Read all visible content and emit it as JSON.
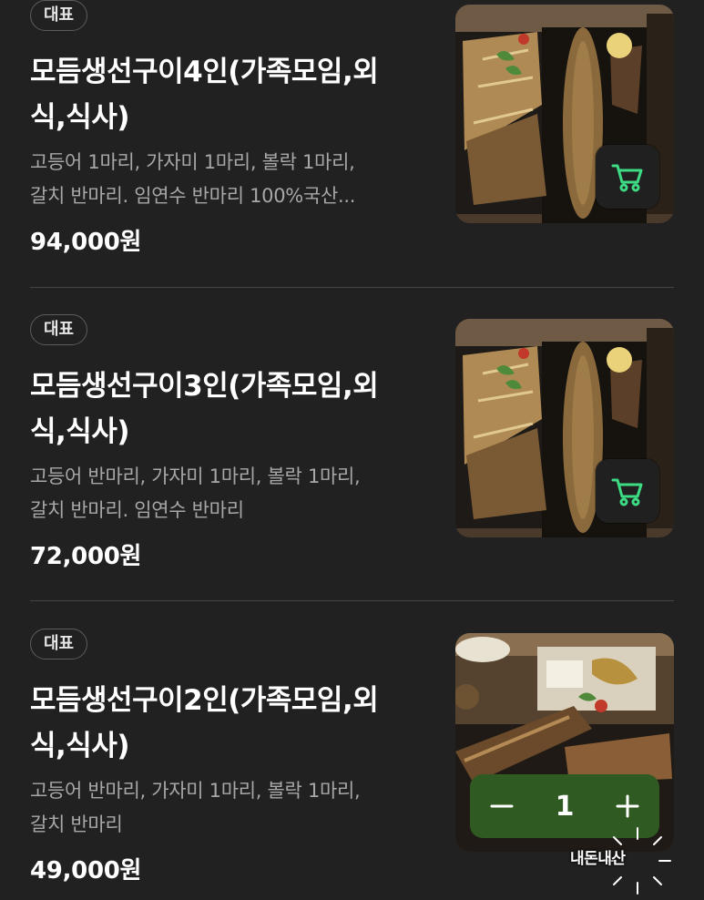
{
  "colors": {
    "background": "#212121",
    "price": "#ffffff",
    "description": "#a7a7a7",
    "cart_icon": "#3ddc84",
    "quantity_box": "#2f5a22"
  },
  "items": [
    {
      "badge": "대표",
      "title_line1": "모듬생선구이4인(가족모임,외",
      "title_line2": "식,식사)",
      "desc_line1": "고등어 1마리, 가자미 1마리, 볼락 1마리,",
      "desc_line2": "갈치 반마리. 임연수 반마리 100%국산...",
      "price": "94,000원",
      "action": "cart-icon"
    },
    {
      "badge": "대표",
      "title_line1": "모듬생선구이3인(가족모임,외",
      "title_line2": "식,식사)",
      "desc_line1": "고등어 반마리, 가자미 1마리, 볼락 1마리,",
      "desc_line2": "갈치 반마리. 임연수 반마리",
      "price": "72,000원",
      "action": "cart-icon"
    },
    {
      "badge": "대표",
      "title_line1": "모듬생선구이2인(가족모임,외",
      "title_line2": "식,식사)",
      "desc_line1": "고등어 반마리, 가자미 1마리, 볼락 1마리,",
      "desc_line2": "갈치 반마리",
      "price": "49,000원",
      "quantity": "1",
      "action": "quantity-stepper"
    }
  ],
  "watermark": "내돈내산"
}
